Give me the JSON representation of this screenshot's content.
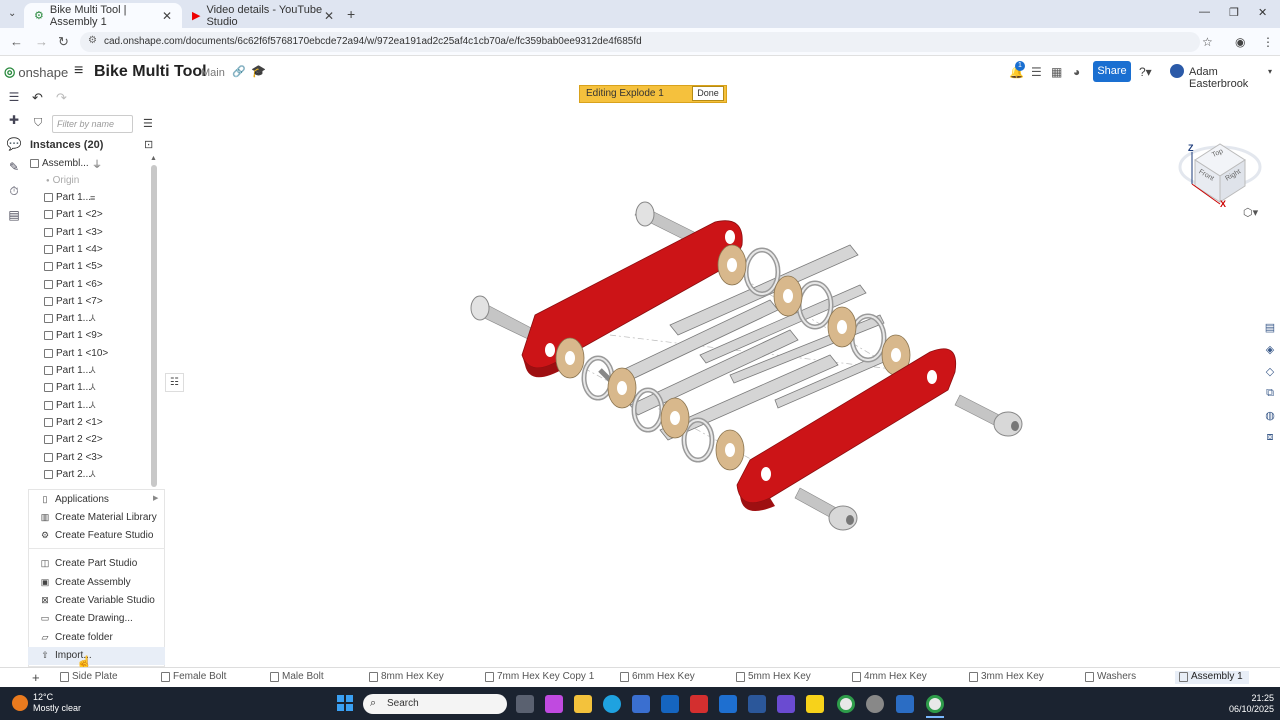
{
  "browser": {
    "tabs": [
      {
        "title": "Bike Multi Tool | Assembly 1",
        "active": true
      },
      {
        "title": "Video details - YouTube Studio",
        "active": false
      }
    ],
    "url": "cad.onshape.com/documents/6c62f6f5768170ebcde72a94/w/972ea191ad2c25af4c1cb70a/e/fc359bab0ee9312de4f685fd"
  },
  "app": {
    "logo": "onshape",
    "doc_title": "Bike Multi Tool",
    "branch": "Main",
    "share_label": "Share",
    "notification_count": "1",
    "user_name": "Adam Easterbrook"
  },
  "banner": {
    "text": "Editing Explode 1",
    "done_label": "Done"
  },
  "tree": {
    "filter_placeholder": "Filter by name",
    "instances_header": "Instances (20)",
    "root": "Assembl...",
    "origin": "Origin",
    "items": [
      "Part 1...",
      "Part 1 <2>",
      "Part 1 <3>",
      "Part 1 <4>",
      "Part 1 <5>",
      "Part 1 <6>",
      "Part 1 <7>",
      "Part 1...",
      "Part 1 <9>",
      "Part 1 <10>",
      "Part 1...",
      "Part 1...",
      "Part 1...",
      "Part 2 <1>",
      "Part 2 <2>",
      "Part 2 <3>",
      "Part 2..."
    ]
  },
  "menu": {
    "applications": "Applications",
    "create_material_library": "Create Material Library",
    "create_feature_studio": "Create Feature Studio",
    "create_part_studio": "Create Part Studio",
    "create_assembly": "Create Assembly",
    "create_variable_studio": "Create Variable Studio",
    "create_drawing": "Create Drawing...",
    "create_folder": "Create folder",
    "import": "Import..."
  },
  "view_cube": {
    "z": "Z",
    "x": "X",
    "top": "Top",
    "front": "Front",
    "right": "Right"
  },
  "bottom_tabs": [
    "Side Plate",
    "Female Bolt",
    "Male Bolt",
    "8mm Hex Key",
    "7mm Hex Key Copy 1",
    "6mm Hex Key",
    "5mm Hex Key",
    "4mm Hex Key",
    "3mm Hex Key",
    "Washers",
    "Assembly 1"
  ],
  "taskbar": {
    "temp": "12°C",
    "weather": "Mostly clear",
    "search_label": "Search",
    "time": "21:25",
    "date": "06/10/2025"
  },
  "colors": {
    "plate": "#cc1417",
    "washer": "#d8b88c",
    "accent": "#1a6fd1",
    "banner": "#f5c13d"
  }
}
